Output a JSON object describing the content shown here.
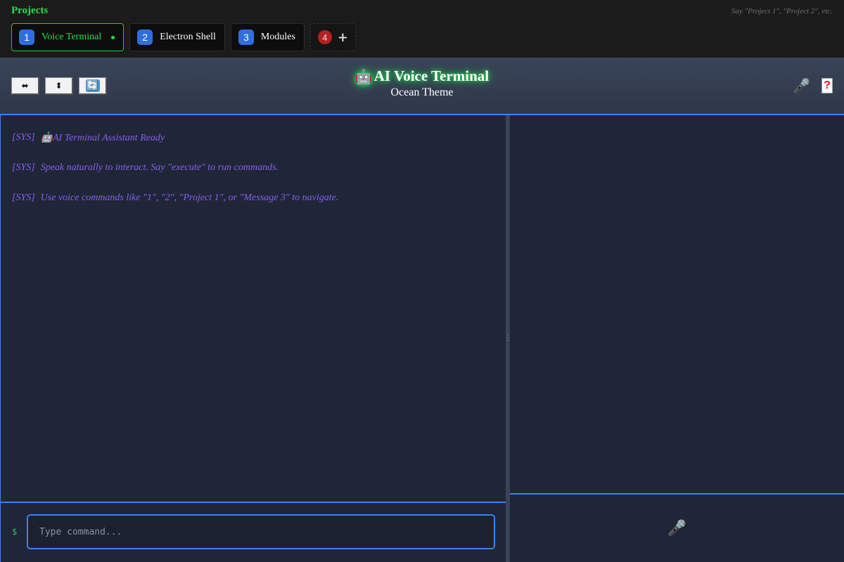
{
  "projects": {
    "label": "Projects",
    "hint": "Say \"Project 1\", \"Project 2\", etc.",
    "tabs": [
      {
        "num": "1",
        "name": "Voice Terminal"
      },
      {
        "num": "2",
        "name": "Electron Shell"
      },
      {
        "num": "3",
        "name": "Modules"
      }
    ],
    "new_tab": {
      "num": "4",
      "plus": "+"
    }
  },
  "header": {
    "title_icon": "🤖",
    "title": "AI Voice Terminal",
    "subtitle": "Ocean Theme",
    "buttons": {
      "horizontal": "⬌",
      "vertical": "⬍",
      "refresh": "🔄"
    },
    "mic_icon": "🎤",
    "help_icon": "?"
  },
  "terminal": {
    "log": [
      {
        "tag": "[SYS]",
        "text": "🤖AI Terminal Assistant Ready"
      },
      {
        "tag": "[SYS]",
        "text": "Speak naturally to interact. Say \"execute\" to run commands."
      },
      {
        "tag": "[SYS]",
        "text": "Use voice commands like \"1\", \"2\", \"Project 1\", or \"Message 3\" to navigate."
      }
    ],
    "prompt": "$",
    "input_placeholder": "Type command...",
    "input_value": ""
  },
  "right_panel": {
    "mic_icon": "🎤"
  },
  "colors": {
    "accent": "#3b82f6",
    "green": "#22e04a",
    "log_purple": "#8b5cf6",
    "badge_red": "#b32222"
  }
}
